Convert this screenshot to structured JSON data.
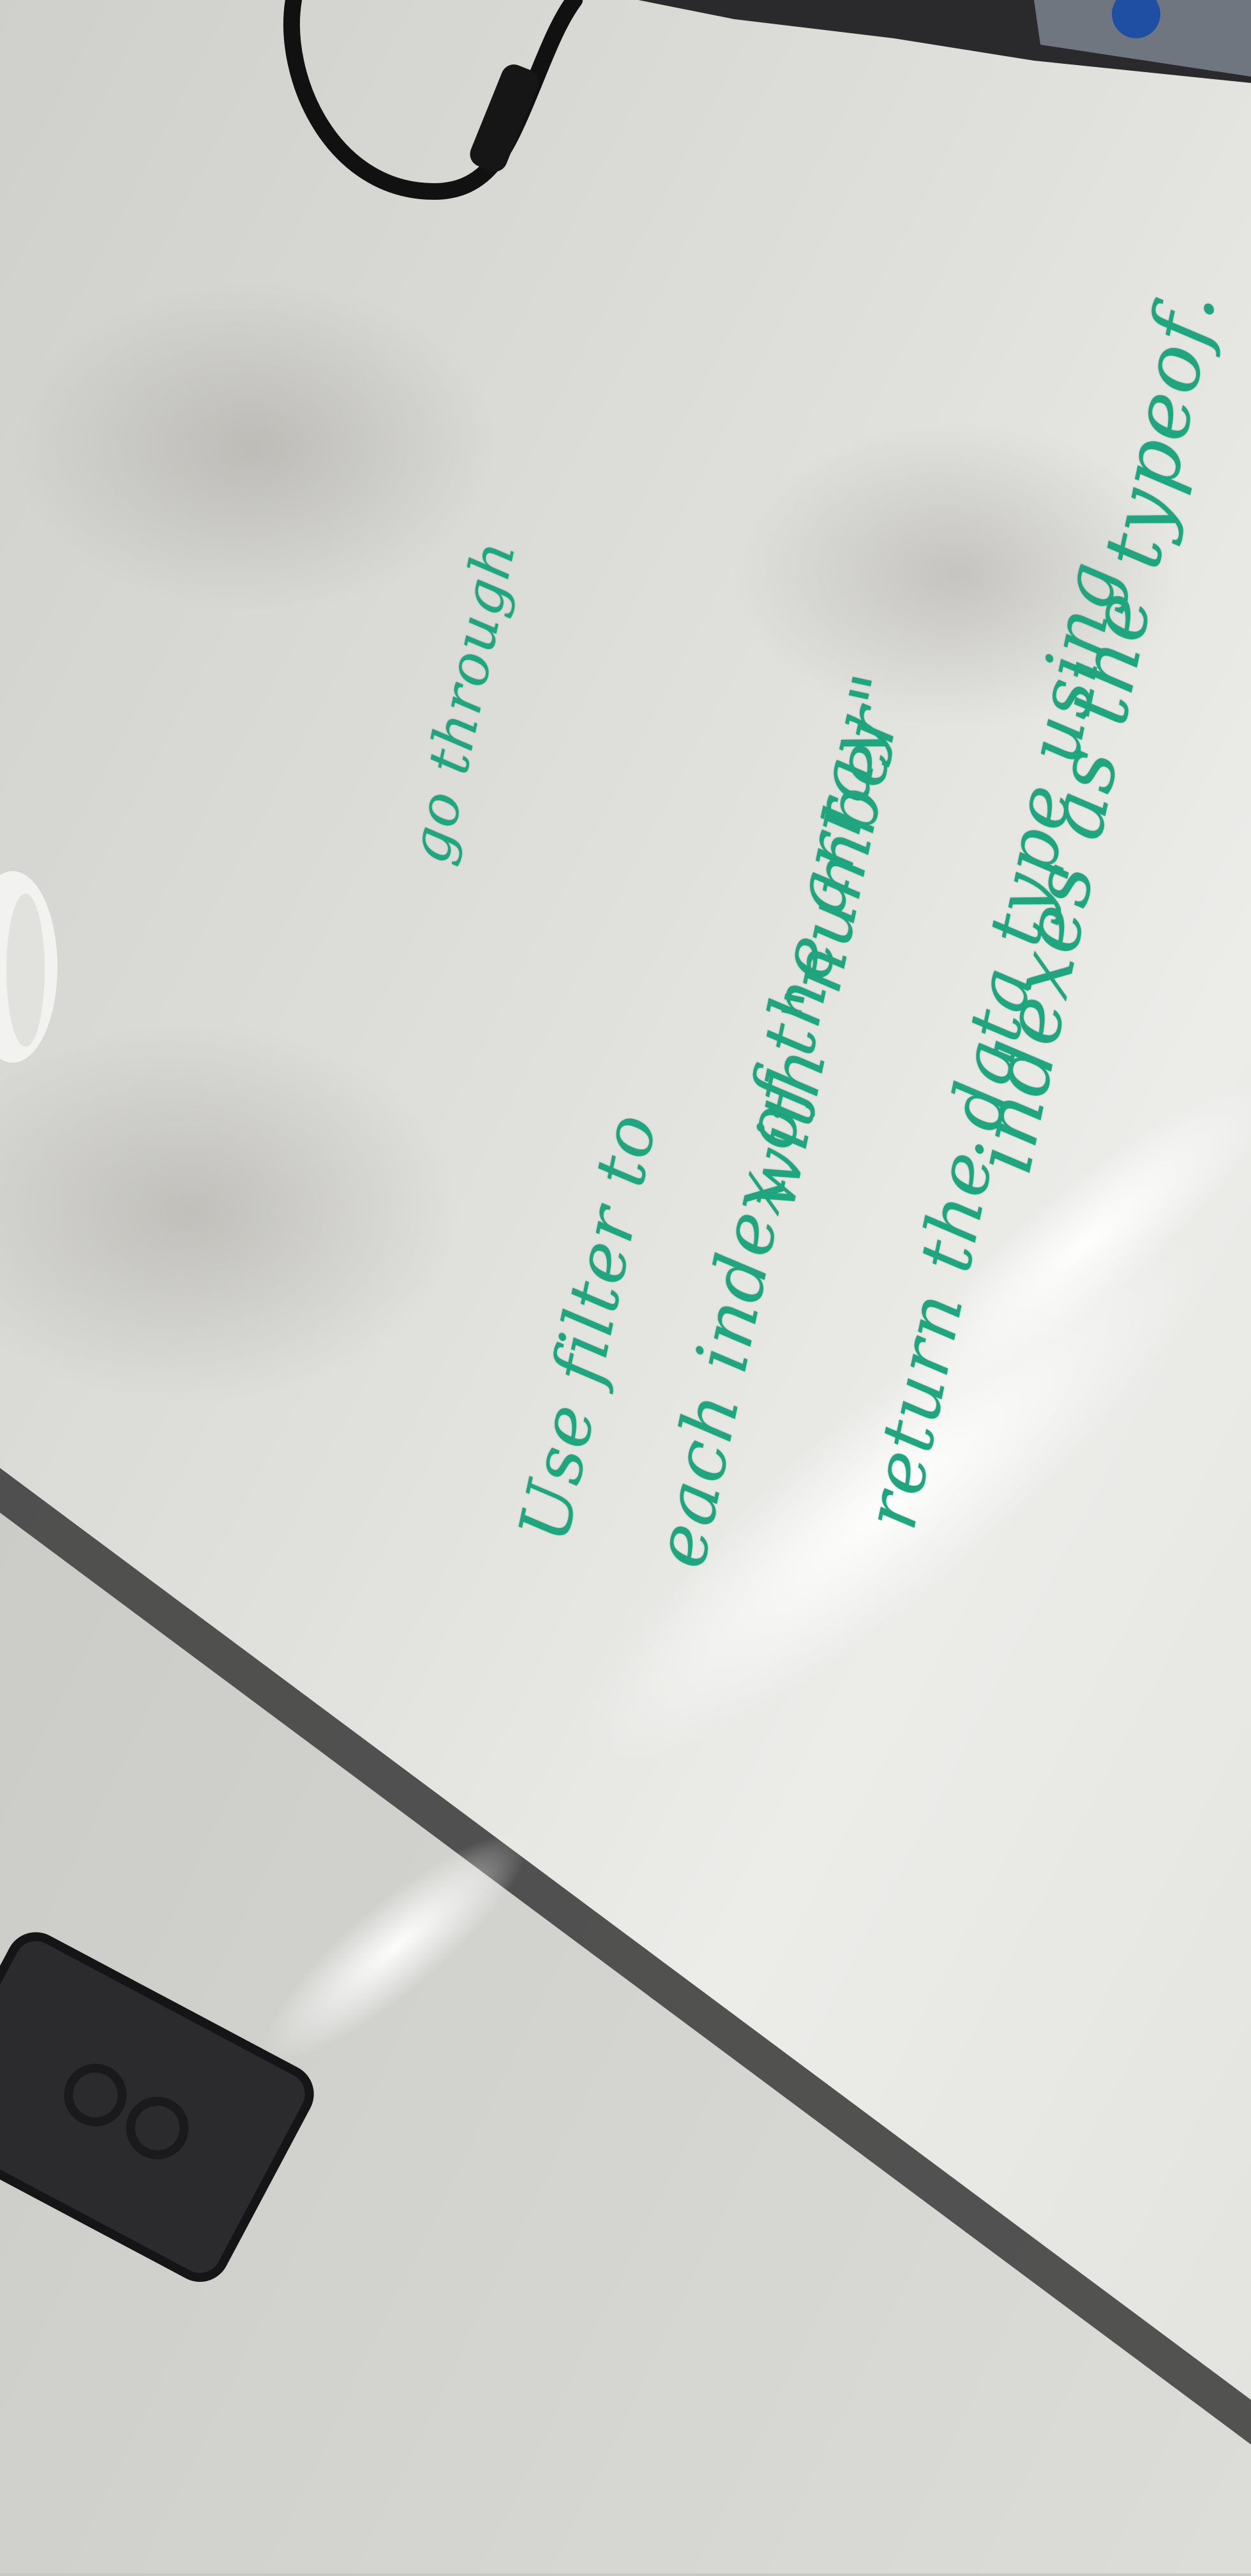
{
  "scene": {
    "description_colors": {
      "desk_surface": "#ddddd9",
      "marker_ink": "#1fa67e",
      "eraser": "#2b2b2d",
      "cable": "#151515"
    }
  },
  "whiteboard_note": {
    "lines": [
      "go through",
      "Use filter to",
      "each index of the array",
      "with \"number\"",
      "return the data type using",
      "indexes as the typeof."
    ]
  }
}
